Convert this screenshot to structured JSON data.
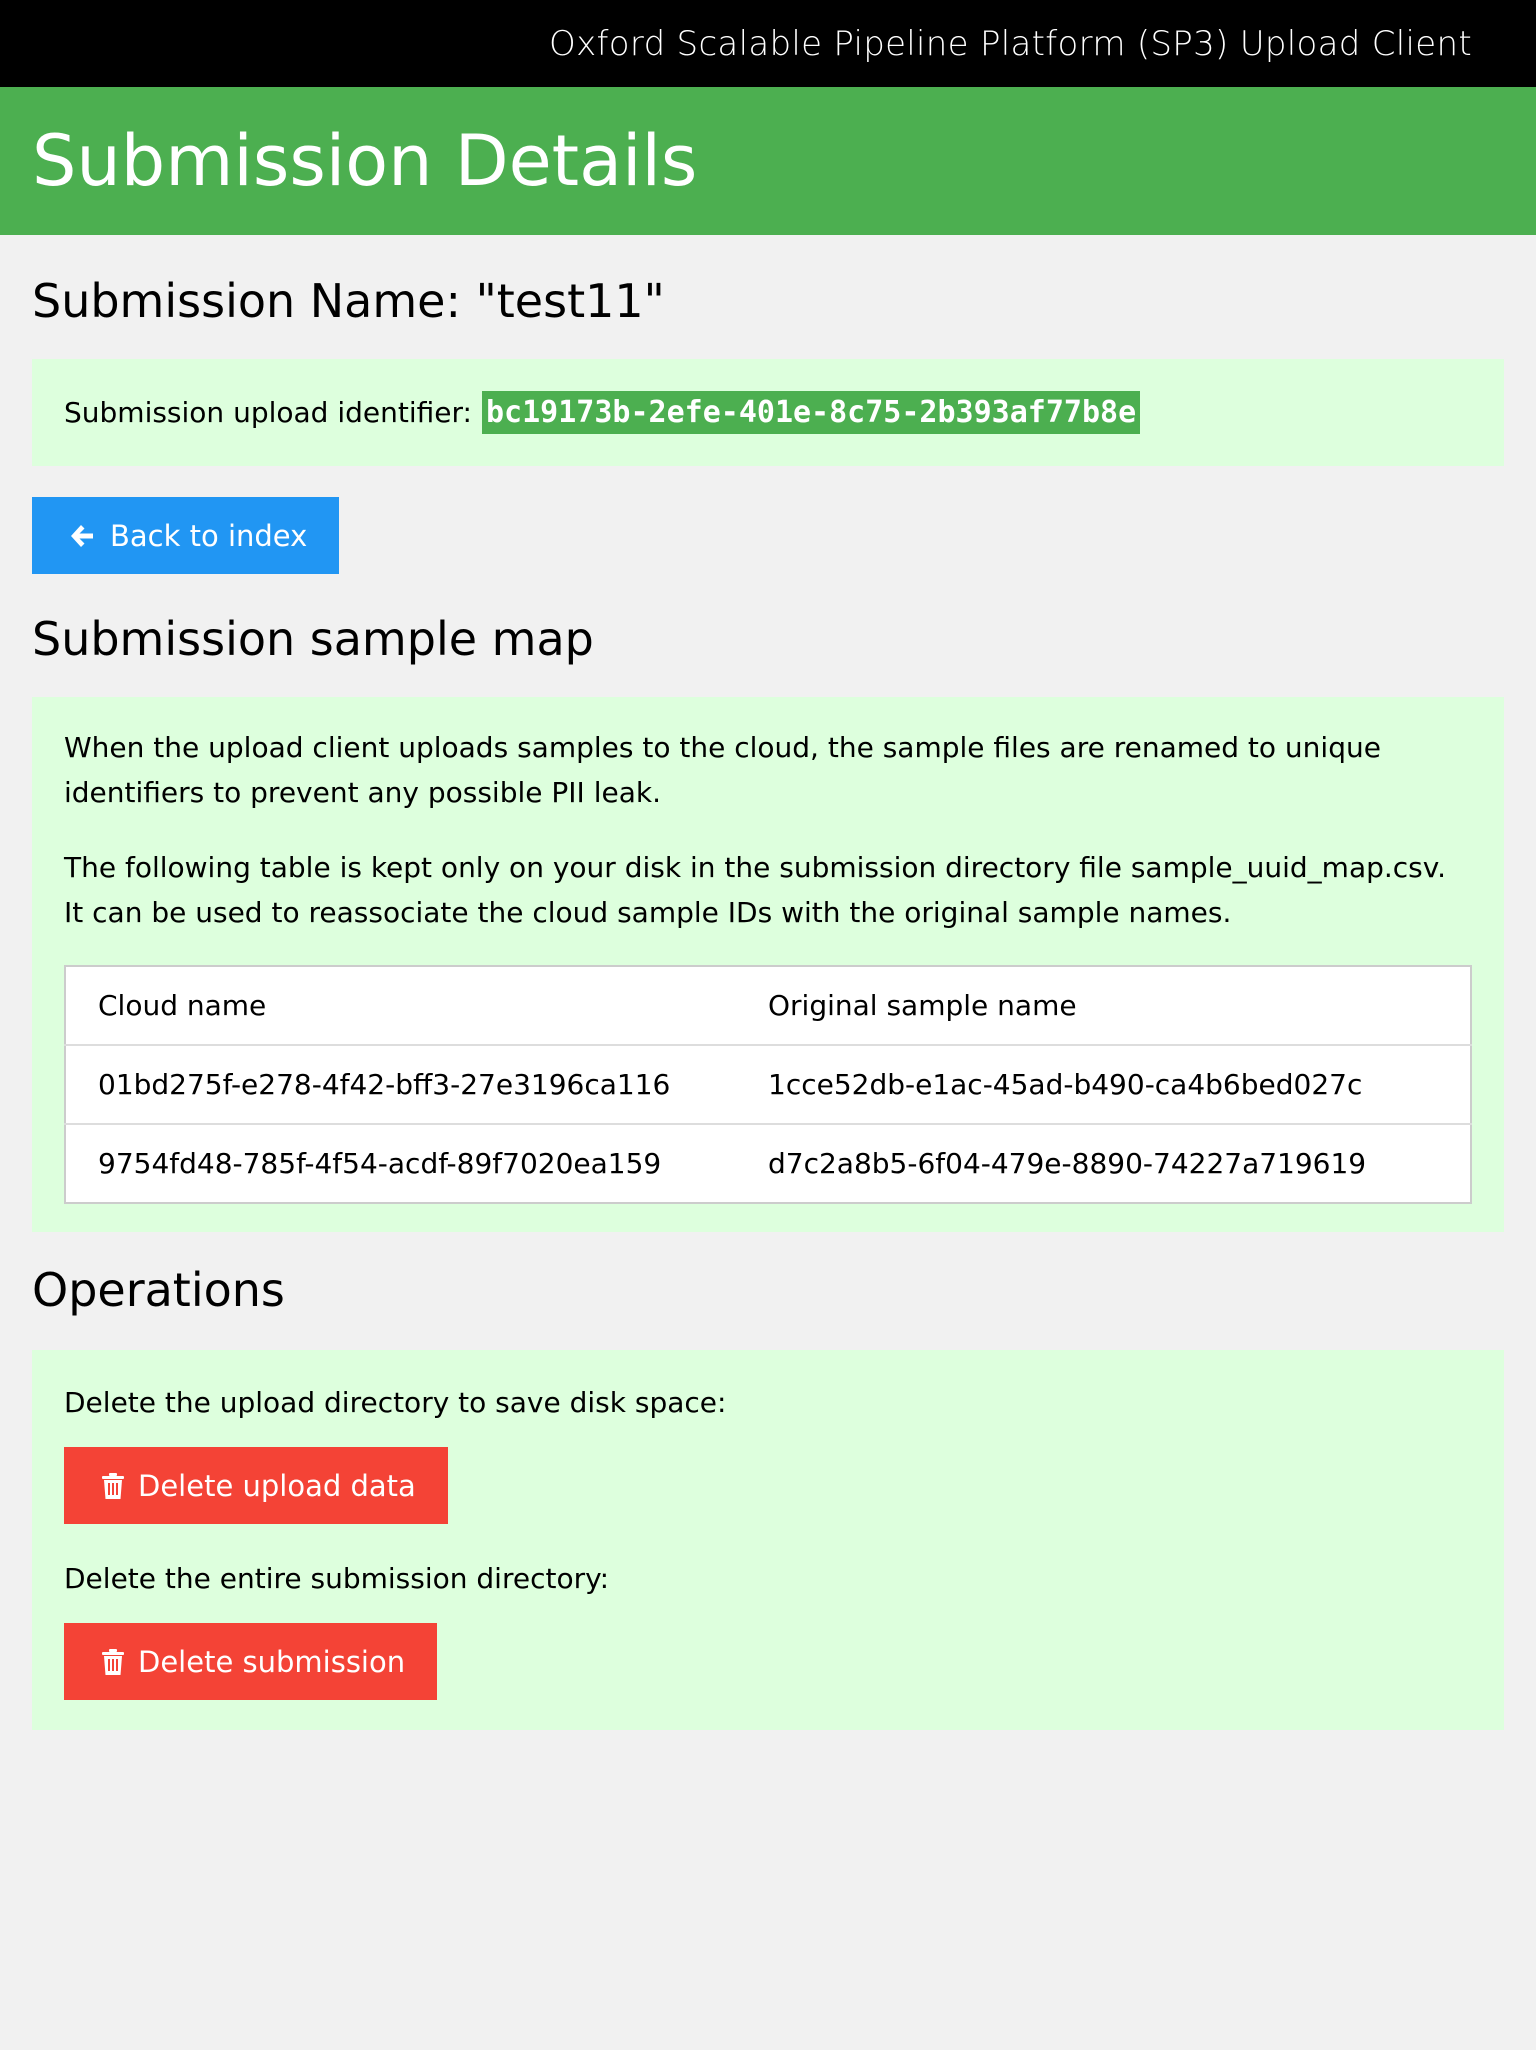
{
  "app": {
    "title": "Oxford Scalable Pipeline Platform (SP3) Upload Client"
  },
  "header": {
    "title": "Submission Details"
  },
  "submission": {
    "name_line": "Submission Name: \"test11\"",
    "identifier_label": "Submission upload identifier:",
    "identifier": "bc19173b-2efe-401e-8c75-2b393af77b8e"
  },
  "back_button": {
    "label": "Back to index",
    "icon": "arrow-left-icon"
  },
  "sample_map": {
    "title": "Submission sample map",
    "paragraph1": "When the upload client uploads samples to the cloud, the sample files are renamed to unique identifiers to prevent any possible PII leak.",
    "paragraph2": "The following table is kept only on your disk in the submission directory file sample_uuid_map.csv. It can be used to reassociate the cloud sample IDs with the original sample names.",
    "columns": [
      "Cloud name",
      "Original sample name"
    ],
    "rows": [
      [
        "01bd275f-e278-4f42-bff3-27e3196ca116",
        "1cce52db-e1ac-45ad-b490-ca4b6bed027c"
      ],
      [
        "9754fd48-785f-4f54-acdf-89f7020ea159",
        "d7c2a8b5-6f04-479e-8890-74227a719619"
      ]
    ]
  },
  "operations": {
    "title": "Operations",
    "upload_text": "Delete the upload directory to save disk space:",
    "upload_button": "Delete upload data",
    "submission_text": "Delete the entire submission directory:",
    "submission_button": "Delete submission",
    "button_icon": "trash-icon"
  },
  "colors": {
    "topbar": "#000000",
    "header": "#4caf50",
    "panel": "#ddffdd",
    "back_button": "#2196f3",
    "delete_button": "#f44336",
    "page_bg": "#f1f1f1"
  }
}
